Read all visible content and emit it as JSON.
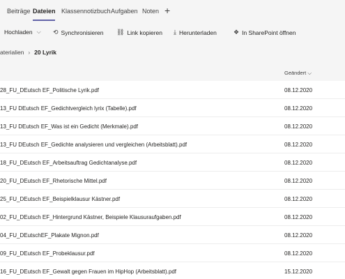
{
  "tabs": [
    {
      "label": "Beiträge"
    },
    {
      "label": "Dateien"
    },
    {
      "label": "Klassennotizbuch"
    },
    {
      "label": "Aufgaben"
    },
    {
      "label": "Noten"
    }
  ],
  "tab_add_label": "+",
  "toolbar": {
    "upload_label": "Hochladen",
    "sync_label": "Synchronisieren",
    "copy_link_label": "Link kopieren",
    "download_label": "Herunterladen",
    "sharepoint_label": "In SharePoint öffnen"
  },
  "breadcrumb": {
    "parent": "aterialien",
    "separator": "›",
    "current": "20 Lyrik"
  },
  "columns": {
    "modified": "Geändert ⌵"
  },
  "files": [
    {
      "name": "28_FU_DEutsch EF_Politische Lyrik.pdf",
      "date": "08.12.2020"
    },
    {
      "name": "13_FU DEutsch EF_Gedichtvergleich lyrix (Tabelle).pdf",
      "date": "08.12.2020"
    },
    {
      "name": "13_FU DEutsch EF_Was ist ein Gedicht (Merkmale).pdf",
      "date": "08.12.2020"
    },
    {
      "name": "13_FU DEutsch EF_Gedichte analysieren und vergleichen (Arbeitsblatt).pdf",
      "date": "08.12.2020"
    },
    {
      "name": "18_FU_DEutsch EF_Arbeitsauftrag Gedichtanalyse.pdf",
      "date": "08.12.2020"
    },
    {
      "name": "20_FU_DEutsch EF_Rhetorische Mittel.pdf",
      "date": "08.12.2020"
    },
    {
      "name": "25_FU_DEutsch EF_Beispielklausur Kästner.pdf",
      "date": "08.12.2020"
    },
    {
      "name": "02_FU_DEutsch EF_Hintergrund Kästner, Beispiele Klausuraufgaben.pdf",
      "date": "08.12.2020"
    },
    {
      "name": "04_FU_DEutschEF_Plakate Mignon.pdf",
      "date": "08.12.2020"
    },
    {
      "name": "09_FU_DEutsch EF_Probeklausur.pdf",
      "date": "08.12.2020"
    },
    {
      "name": "16_FU_DEutsch EF_Gewalt gegen Frauen im HipHop (Arbeitsblatt).pdf",
      "date": "15.12.2020"
    }
  ],
  "colors": {
    "accent": "#6264a7",
    "background": "#f5f5f5",
    "row_background": "#ffffff"
  }
}
